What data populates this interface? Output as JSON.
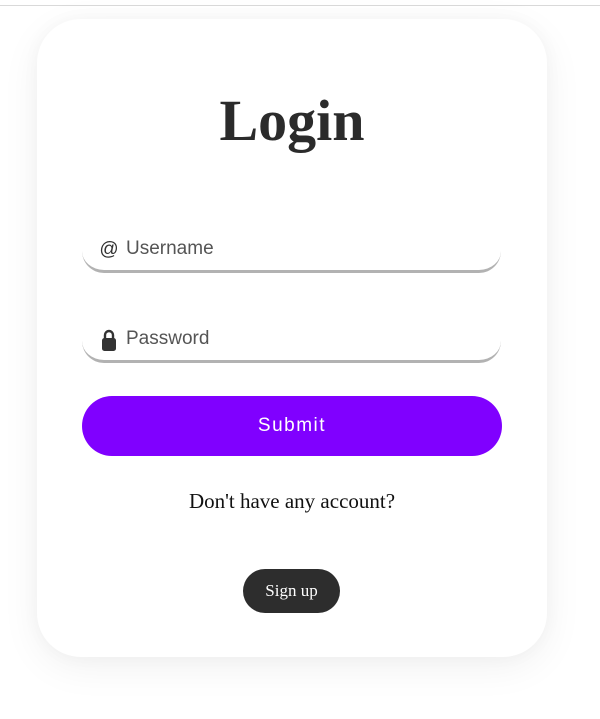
{
  "login": {
    "title": "Login",
    "username": {
      "icon": "at-sign-icon",
      "icon_glyph": "@",
      "placeholder": "Username",
      "value": ""
    },
    "password": {
      "icon": "lock-icon",
      "placeholder": "Password",
      "value": ""
    },
    "submit_label": "Submit",
    "signup_prompt": "Don't have any account?",
    "signup_label": "Sign up"
  },
  "colors": {
    "accent": "#8000ff",
    "title": "#2b2b2b",
    "signup_button": "#2d2d2d",
    "field_underline": "#b2b2b2"
  }
}
